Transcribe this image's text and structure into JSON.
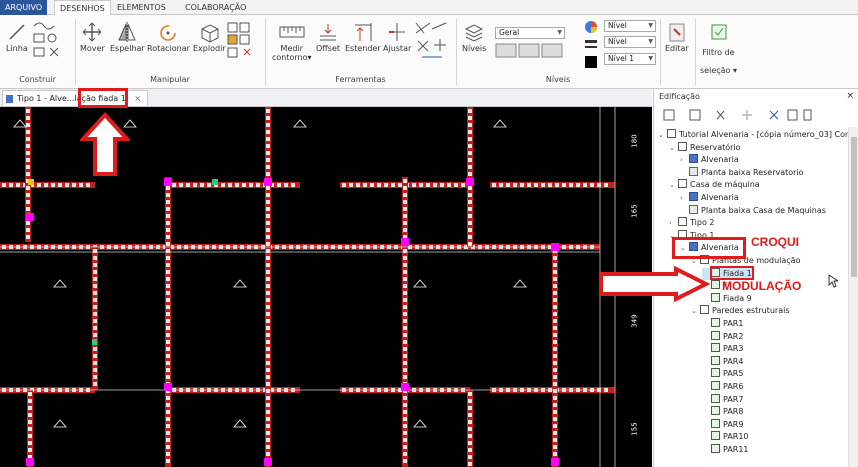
{
  "ribbon_tabs": [
    "ARQUIVO",
    "DESENHOS",
    "ELEMENTOS",
    "COLABORAÇÃO"
  ],
  "groups": {
    "construir": "Construir",
    "manipular": "Manipular",
    "ferramentas": "Ferramentas",
    "niveis": "Níveis"
  },
  "buttons": {
    "linha": "Linha",
    "mover": "Mover",
    "espelhar": "Espelhar",
    "rotacionar": "Rotacionar",
    "explodir": "Explodir",
    "medir_contorno": "Medir\ncontorno▾",
    "offset": "Offset",
    "estender": "Estender",
    "ajustar": "Ajustar",
    "niveis": "Níveis",
    "editar": "Editar",
    "filtro": "Filtro de\nseleção ▾"
  },
  "combos": {
    "geral": "Geral",
    "nivel1": "Nível",
    "nivel2": "Nível",
    "nivel3": "Nível 1"
  },
  "document_tab": "Tipo 1 - Alve...lação fiada 1",
  "panel": {
    "title": "Edificação",
    "tree": [
      {
        "label": "Tutorial Alvenaria - [cópia número_03] Con",
        "depth": 0,
        "toggle": "⌄",
        "icon": "plain"
      },
      {
        "label": "Reservatório",
        "depth": 1,
        "toggle": "⌄",
        "icon": "plain"
      },
      {
        "label": "Alvenaria",
        "depth": 2,
        "toggle": "›",
        "icon": "blue"
      },
      {
        "label": "Planta baixa Reservatorio",
        "depth": 2,
        "toggle": "",
        "icon": "red"
      },
      {
        "label": "Casa de máquina",
        "depth": 1,
        "toggle": "⌄",
        "icon": "plain"
      },
      {
        "label": "Alvenaria",
        "depth": 2,
        "toggle": "›",
        "icon": "blue"
      },
      {
        "label": "Planta baixa Casa de Maquinas",
        "depth": 2,
        "toggle": "",
        "icon": "red"
      },
      {
        "label": "Tipo 2",
        "depth": 1,
        "toggle": "›",
        "icon": "plain"
      },
      {
        "label": "Tipo 1",
        "depth": 1,
        "toggle": "⌄",
        "icon": "plain"
      },
      {
        "label": "Alvenaria",
        "depth": 2,
        "toggle": "⌄",
        "icon": "blue"
      },
      {
        "label": "Plantas de modulação",
        "depth": 3,
        "toggle": "⌄",
        "icon": "plain"
      },
      {
        "label": "Fiada 1",
        "depth": 4,
        "toggle": "",
        "icon": "grid"
      },
      {
        "label": "F",
        "depth": 4,
        "toggle": "",
        "icon": "grid"
      },
      {
        "label": "Fiada 9",
        "depth": 4,
        "toggle": "",
        "icon": "grid"
      },
      {
        "label": "Paredes estruturais",
        "depth": 3,
        "toggle": "⌄",
        "icon": "plain"
      },
      {
        "label": "PAR1",
        "depth": 4,
        "toggle": "",
        "icon": "grid"
      },
      {
        "label": "PAR2",
        "depth": 4,
        "toggle": "",
        "icon": "grid"
      },
      {
        "label": "PAR3",
        "depth": 4,
        "toggle": "",
        "icon": "grid"
      },
      {
        "label": "PAR4",
        "depth": 4,
        "toggle": "",
        "icon": "grid"
      },
      {
        "label": "PAR5",
        "depth": 4,
        "toggle": "",
        "icon": "grid"
      },
      {
        "label": "PAR6",
        "depth": 4,
        "toggle": "",
        "icon": "grid"
      },
      {
        "label": "PAR7",
        "depth": 4,
        "toggle": "",
        "icon": "grid"
      },
      {
        "label": "PAR8",
        "depth": 4,
        "toggle": "",
        "icon": "grid"
      },
      {
        "label": "PAR9",
        "depth": 4,
        "toggle": "",
        "icon": "grid"
      },
      {
        "label": "PAR10",
        "depth": 4,
        "toggle": "",
        "icon": "grid"
      },
      {
        "label": "PAR11",
        "depth": 4,
        "toggle": "",
        "icon": "grid"
      }
    ]
  },
  "annotations": {
    "croqui": "CROQUI",
    "modulacao": "MODULAÇÃO"
  },
  "dimension_labels": [
    "180",
    "165",
    "349",
    "155"
  ],
  "colors": {
    "file_tab": "#2b579a",
    "annotation": "#e01b1b",
    "wall": "#c0201e",
    "block": "#e6e6e6",
    "magenta": "#ff00ff"
  }
}
